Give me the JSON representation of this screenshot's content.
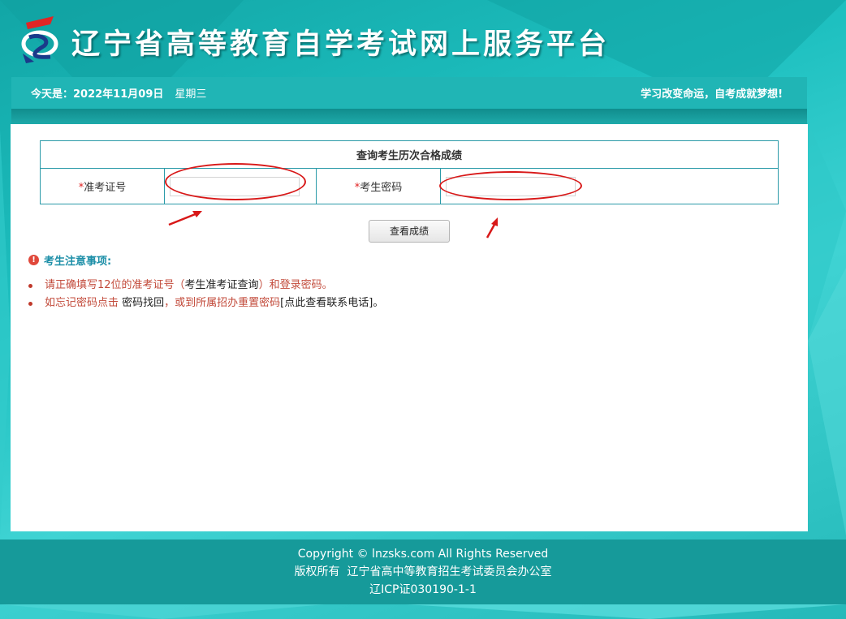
{
  "header": {
    "site_title": "辽宁省高等教育自学考试网上服务平台"
  },
  "datebar": {
    "date_text": "今天是：2022年11月09日",
    "weekday": "星期三",
    "slogan": "学习改变命运，自考成就梦想!"
  },
  "form": {
    "table_title": "查询考生历次合格成绩",
    "required_mark": "*",
    "exam_id_label": "准考证号",
    "exam_id_value": "",
    "password_label": "考生密码",
    "password_value": "",
    "submit_label": "查看成绩"
  },
  "notes": {
    "title": "考生注意事项:",
    "item1_red_a": "请正确填写12位的准考证号（",
    "item1_dark": "考生准考证查询",
    "item1_red_b": "）和登录密码。",
    "item2_red_a": "如忘记密码点击 ",
    "item2_link": "密码找回",
    "item2_red_b": "，或到所属招办重置密码",
    "item2_dark": "[点此查看联系电话]。"
  },
  "footer": {
    "copyright": "Copyright © lnzsks.com All Rights Reserved",
    "owner": "版权所有  辽宁省高中等教育招生考试委员会办公室",
    "icp": "辽ICP证030190-1-1"
  },
  "colors": {
    "teal": "#1ec0c0",
    "annotation_red": "#d81818"
  }
}
